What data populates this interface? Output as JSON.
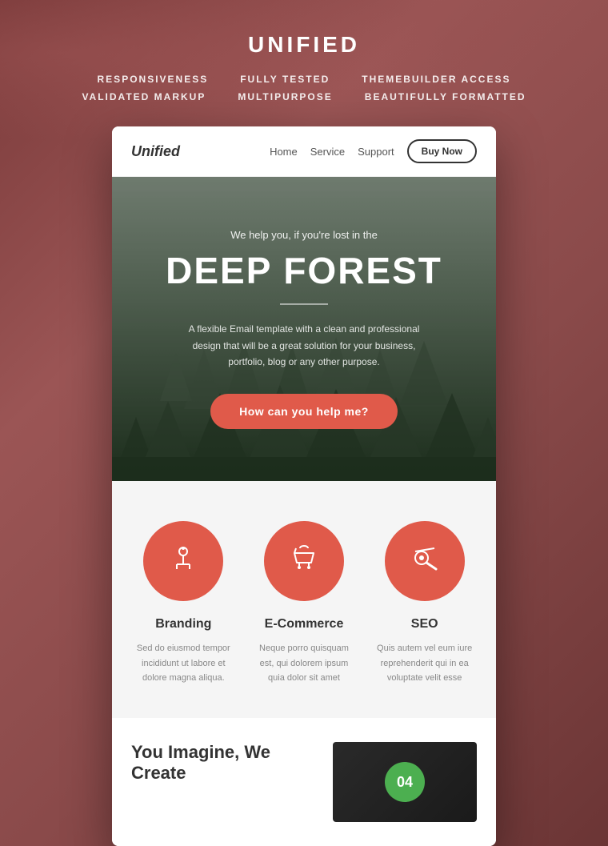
{
  "header": {
    "title": "UNIFIED",
    "features": [
      "RESPONSIVENESS",
      "FULLY TESTED",
      "THEMEBUILDER ACCESS",
      "VALIDATED MARKUP",
      "MULTIPURPOSE",
      "BEAUTIFULLY FORMATTED"
    ]
  },
  "navbar": {
    "brand": "Unified",
    "links": [
      "Home",
      "Service",
      "Support"
    ],
    "cta_label": "Buy Now"
  },
  "hero": {
    "subtitle": "We help you, if you're lost in the",
    "title": "DEEP FOREST",
    "description": "A flexible Email template with a clean and professional design that will be a great solution for your business, portfolio, blog or any other purpose.",
    "cta_label": "How can you help me?"
  },
  "services": [
    {
      "icon": "⚗",
      "title": "Branding",
      "description": "Sed do eiusmod tempor incididunt ut labore et dolore magna aliqua."
    },
    {
      "icon": "🛍",
      "title": "E-Commerce",
      "description": "Neque porro quisquam est, qui dolorem ipsum quia dolor sit amet"
    },
    {
      "icon": "🚀",
      "title": "SEO",
      "description": "Quis autem vel eum iure reprehenderit qui in ea voluptate velit esse"
    }
  ],
  "bottom": {
    "heading_line1": "You Imagine, We",
    "heading_line2": "Create",
    "badge_text": "04"
  },
  "colors": {
    "accent": "#e05a4a",
    "dark": "#333333",
    "muted": "#888888",
    "bg_light": "#f5f5f5"
  }
}
